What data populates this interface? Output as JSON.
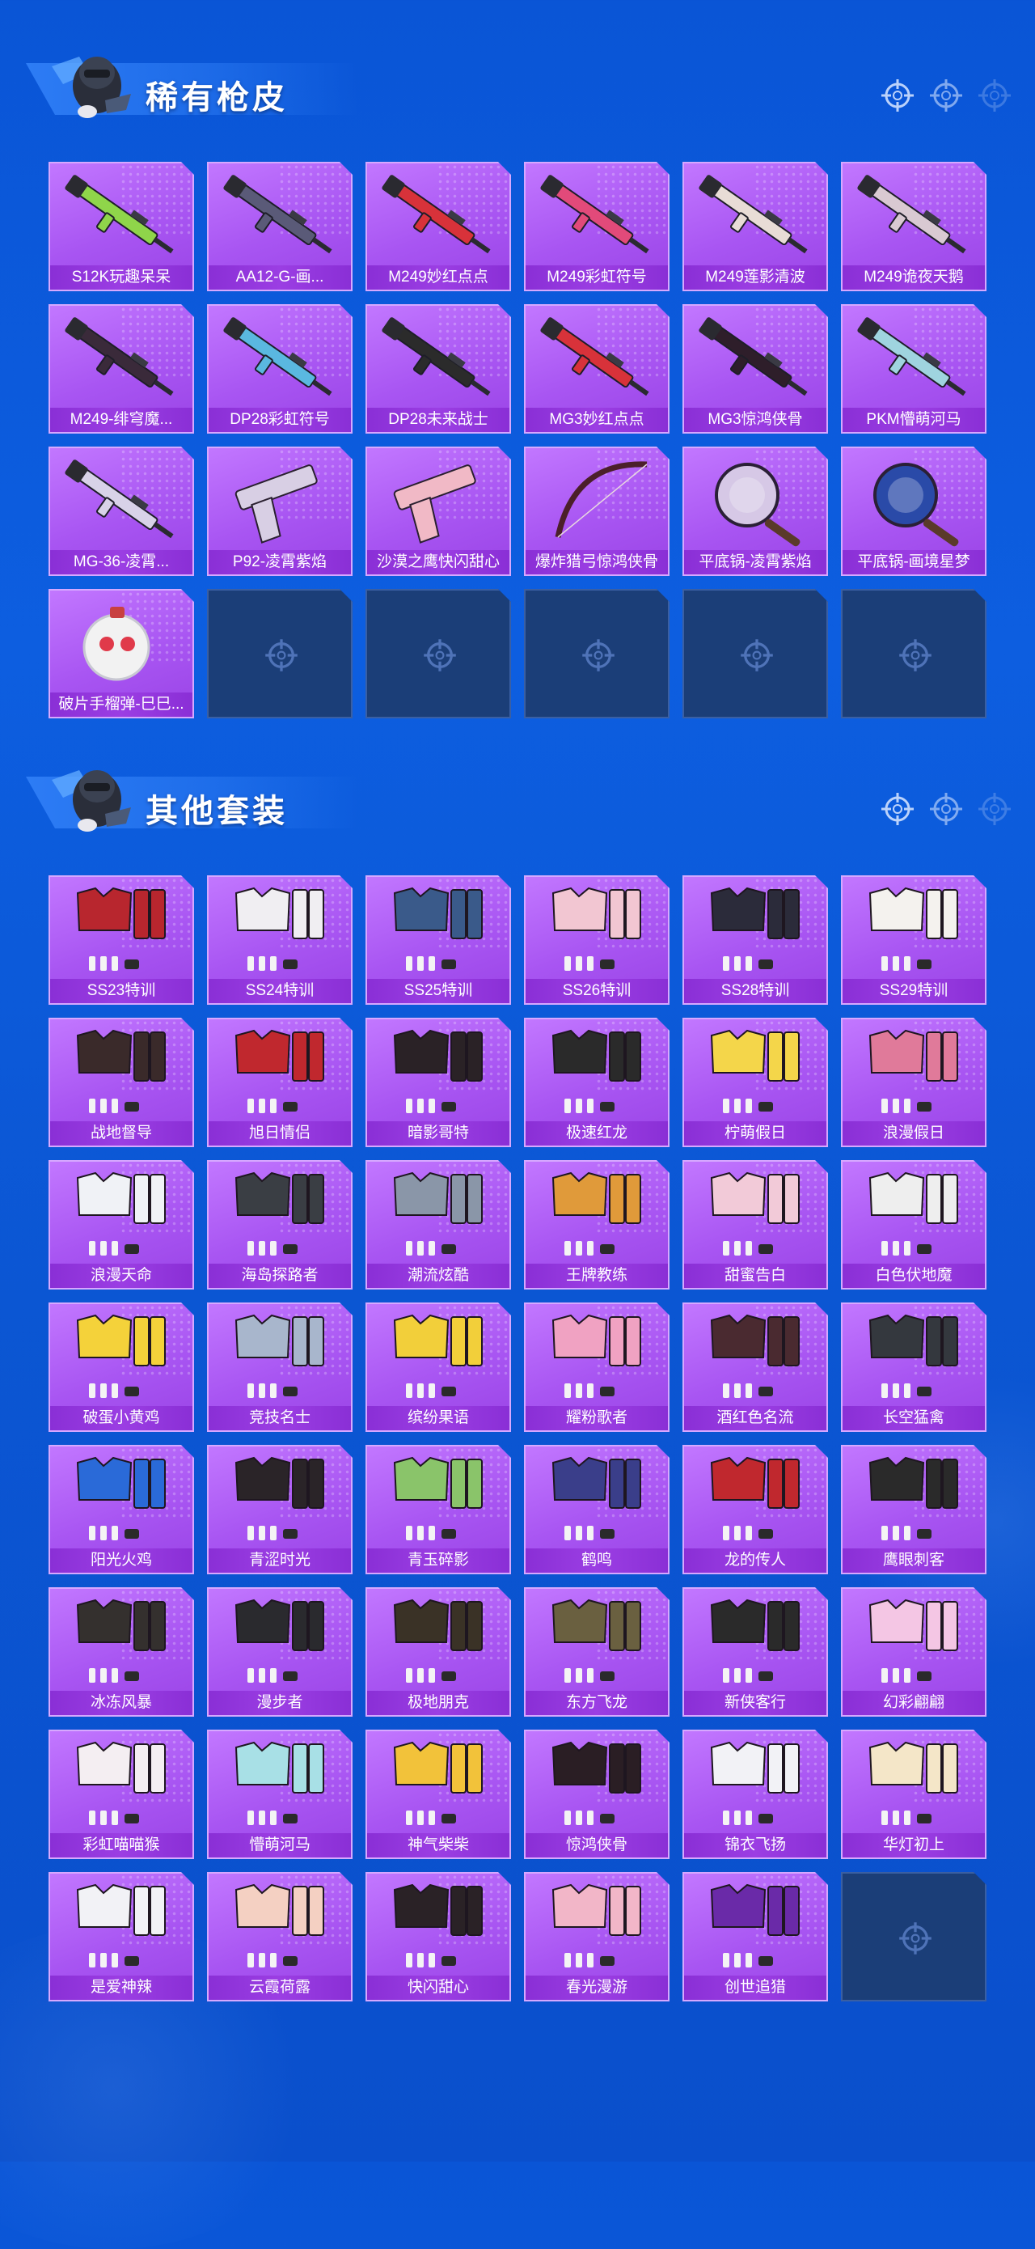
{
  "sections": [
    {
      "title": "稀有枪皮",
      "items": [
        {
          "label": "S12K玩趣呆呆",
          "icon": "shotgun-skin-icon",
          "color": "#8fd54a"
        },
        {
          "label": "AA12-G-画...",
          "icon": "shotgun-skin-icon",
          "color": "#5a5a78"
        },
        {
          "label": "M249妙红点点",
          "icon": "machine-gun-skin-icon",
          "color": "#d8323a"
        },
        {
          "label": "M249彩虹符号",
          "icon": "machine-gun-skin-icon",
          "color": "#e24a7a"
        },
        {
          "label": "M249莲影清波",
          "icon": "machine-gun-skin-icon",
          "color": "#e8dcd6"
        },
        {
          "label": "M249诡夜天鹅",
          "icon": "machine-gun-skin-icon",
          "color": "#d9c9d2"
        },
        {
          "label": "M249-绯穹魔...",
          "icon": "machine-gun-skin-icon",
          "color": "#3a2a3a"
        },
        {
          "label": "DP28彩虹符号",
          "icon": "machine-gun-skin-icon",
          "color": "#5ab8e0"
        },
        {
          "label": "DP28未来战士",
          "icon": "machine-gun-skin-icon",
          "color": "#2b2b2b"
        },
        {
          "label": "MG3妙红点点",
          "icon": "machine-gun-skin-icon",
          "color": "#d8323a"
        },
        {
          "label": "MG3惊鸿侠骨",
          "icon": "machine-gun-skin-icon",
          "color": "#2e1e2a"
        },
        {
          "label": "PKM懵萌河马",
          "icon": "machine-gun-skin-icon",
          "color": "#9fd4df"
        },
        {
          "label": "MG-36-凌霄...",
          "icon": "rifle-skin-icon",
          "color": "#d8d2e8"
        },
        {
          "label": "P92-凌霄紫焰",
          "icon": "pistol-skin-icon",
          "color": "#d8cfe4"
        },
        {
          "label": "沙漠之鹰快闪甜心",
          "icon": "pistol-skin-icon",
          "color": "#f1b9c6"
        },
        {
          "label": "爆炸猎弓惊鸿侠骨",
          "icon": "bow-skin-icon",
          "color": "#4b1f2a"
        },
        {
          "label": "平底锅-凌霄紫焰",
          "icon": "pan-skin-icon",
          "color": "#d6c8e6"
        },
        {
          "label": "平底锅-画境星梦",
          "icon": "pan-skin-icon",
          "color": "#2a4aa8"
        },
        {
          "label": "破片手榴弹-巳巳...",
          "icon": "grenade-skin-icon",
          "color": "#f2f2f2"
        }
      ],
      "empty_slots": 5
    },
    {
      "title": "其他套装",
      "items": [
        {
          "label": "SS23特训",
          "icon": "outfit-icon",
          "color": "#b8262e"
        },
        {
          "label": "SS24特训",
          "icon": "outfit-icon",
          "color": "#f0eef2"
        },
        {
          "label": "SS25特训",
          "icon": "outfit-icon",
          "color": "#3a5a8a"
        },
        {
          "label": "SS26特训",
          "icon": "outfit-icon",
          "color": "#f2c6d2"
        },
        {
          "label": "SS28特训",
          "icon": "outfit-icon",
          "color": "#2b2b3a"
        },
        {
          "label": "SS29特训",
          "icon": "outfit-icon",
          "color": "#f4f2ee"
        },
        {
          "label": "战地督导",
          "icon": "outfit-icon",
          "color": "#3a2a2a"
        },
        {
          "label": "旭日情侣",
          "icon": "outfit-icon",
          "color": "#c0282e"
        },
        {
          "label": "暗影哥特",
          "icon": "outfit-icon",
          "color": "#2a2226"
        },
        {
          "label": "极速红龙",
          "icon": "outfit-icon",
          "color": "#2a2a2a"
        },
        {
          "label": "柠萌假日",
          "icon": "outfit-icon",
          "color": "#f4d64a"
        },
        {
          "label": "浪漫假日",
          "icon": "outfit-icon",
          "color": "#e07a9a"
        },
        {
          "label": "浪漫天命",
          "icon": "outfit-icon",
          "color": "#f0f2f6"
        },
        {
          "label": "海岛探路者",
          "icon": "outfit-icon",
          "color": "#3a3e44"
        },
        {
          "label": "潮流炫酷",
          "icon": "outfit-icon",
          "color": "#8a96a8"
        },
        {
          "label": "王牌教练",
          "icon": "outfit-icon",
          "color": "#e09a3a"
        },
        {
          "label": "甜蜜告白",
          "icon": "outfit-icon",
          "color": "#f2cad8"
        },
        {
          "label": "白色伏地魔",
          "icon": "outfit-icon",
          "color": "#eeeeee"
        },
        {
          "label": "破蛋小黄鸡",
          "icon": "outfit-icon",
          "color": "#f4d23a"
        },
        {
          "label": "竞技名士",
          "icon": "outfit-icon",
          "color": "#a8b6cc"
        },
        {
          "label": "缤纷果语",
          "icon": "outfit-icon",
          "color": "#f2cf3a"
        },
        {
          "label": "耀粉歌者",
          "icon": "outfit-icon",
          "color": "#f0a2c2"
        },
        {
          "label": "酒红色名流",
          "icon": "outfit-icon",
          "color": "#4a2a30"
        },
        {
          "label": "长空猛禽",
          "icon": "outfit-icon",
          "color": "#34383e"
        },
        {
          "label": "阳光火鸡",
          "icon": "outfit-icon",
          "color": "#2a6ad8"
        },
        {
          "label": "青涩时光",
          "icon": "outfit-icon",
          "color": "#2a2428"
        },
        {
          "label": "青玉碎影",
          "icon": "outfit-icon",
          "color": "#8ac46a"
        },
        {
          "label": "鹤鸣",
          "icon": "outfit-icon",
          "color": "#3a3e8a"
        },
        {
          "label": "龙的传人",
          "icon": "outfit-icon",
          "color": "#c0282e"
        },
        {
          "label": "鹰眼刺客",
          "icon": "outfit-icon",
          "color": "#2a2a2a"
        },
        {
          "label": "冰冻风暴",
          "icon": "outfit-icon",
          "color": "#34302e"
        },
        {
          "label": "漫步者",
          "icon": "outfit-icon",
          "color": "#2a2a2e"
        },
        {
          "label": "极地朋克",
          "icon": "outfit-icon",
          "color": "#3a3226"
        },
        {
          "label": "东方飞龙",
          "icon": "outfit-icon",
          "color": "#6a6040"
        },
        {
          "label": "新侠客行",
          "icon": "outfit-icon",
          "color": "#2a2a2a"
        },
        {
          "label": "幻彩翩翩",
          "icon": "outfit-icon",
          "color": "#f4c6e4"
        },
        {
          "label": "彩虹喵喵猴",
          "icon": "outfit-icon",
          "color": "#f4eef2"
        },
        {
          "label": "懵萌河马",
          "icon": "outfit-icon",
          "color": "#a8e0e6"
        },
        {
          "label": "神气柴柴",
          "icon": "outfit-icon",
          "color": "#f2c23a"
        },
        {
          "label": "惊鸿侠骨",
          "icon": "outfit-icon",
          "color": "#2a1e24"
        },
        {
          "label": "锦衣飞扬",
          "icon": "outfit-icon",
          "color": "#f2f2f6"
        },
        {
          "label": "华灯初上",
          "icon": "outfit-icon",
          "color": "#f4e6c8"
        },
        {
          "label": "是爱神辣",
          "icon": "outfit-icon",
          "color": "#f2f2f6"
        },
        {
          "label": "云霞荷露",
          "icon": "outfit-icon",
          "color": "#f4d0c2"
        },
        {
          "label": "快闪甜心",
          "icon": "outfit-icon",
          "color": "#2a2226"
        },
        {
          "label": "春光漫游",
          "icon": "outfit-icon",
          "color": "#f2b6c8"
        },
        {
          "label": "创世追猎",
          "icon": "outfit-icon",
          "color": "#6a2aa8"
        }
      ],
      "empty_slots": 1
    }
  ],
  "colors": {
    "background": "#0b56d3",
    "card": "#a855f2",
    "card_label": "#8a2fd6",
    "empty_card": "#1b3e78"
  }
}
